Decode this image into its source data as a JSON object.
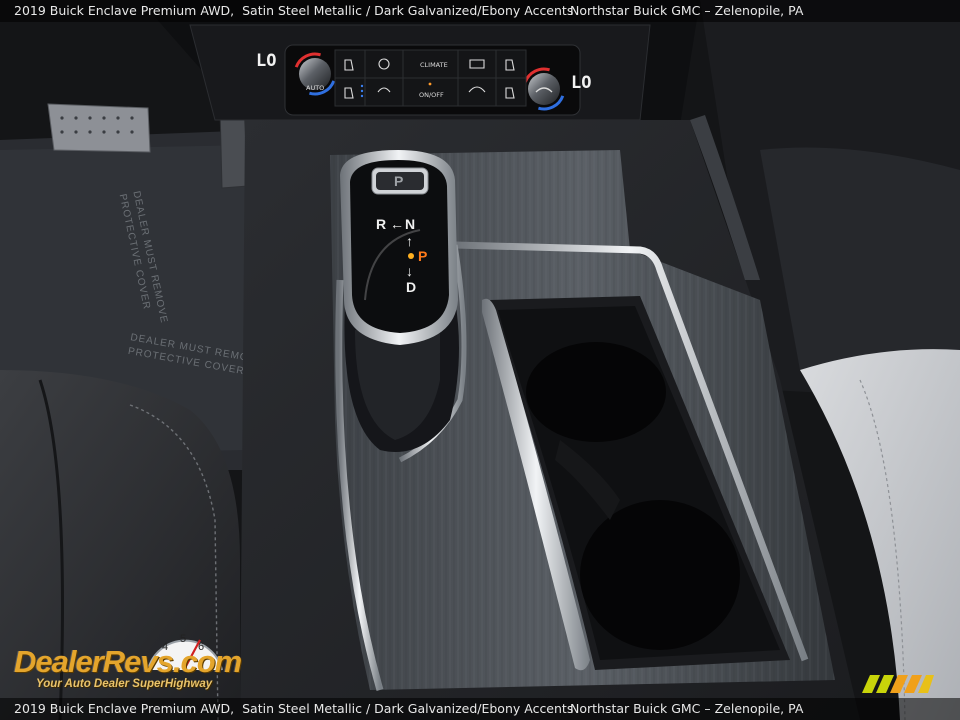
{
  "caption": {
    "vehicle": "2019 Buick Enclave Premium AWD,",
    "exterior": "Satin Steel Metallic",
    "separator": "/",
    "interior": "Dark Galvanized/Ebony Accents",
    "dealer": "Northstar Buick GMC – Zelenopile, PA"
  },
  "climate_panel": {
    "left_temp": "LO",
    "right_temp": "LO",
    "left_knob_label": "AUTO",
    "climate_label": "CLIMATE",
    "onoff_label": "ON/OFF",
    "knob_ring_colors": [
      "#e03030",
      "#2f6fe0"
    ]
  },
  "shifter": {
    "park_button": "P",
    "reverse": "R",
    "neutral": "N",
    "park_indicator": "P",
    "drive": "D",
    "arrow_left": "←",
    "arrow_up": "↑",
    "arrow_down": "↓",
    "park_color": "#ff7a1a"
  },
  "floor_mat_text": [
    "DEALER MUST REMOVE",
    "PROTECTIVE COVER"
  ],
  "watermark": {
    "gauge_digits": [
      "4",
      "5",
      "6"
    ],
    "title": "DealerRevs.com",
    "tagline": "Your Auto Dealer SuperHighway"
  },
  "colors": {
    "watermark_gold": "#e4a52c",
    "corner_logo_yellow": "#c8d40a",
    "corner_logo_orange": "#f0a01a"
  }
}
